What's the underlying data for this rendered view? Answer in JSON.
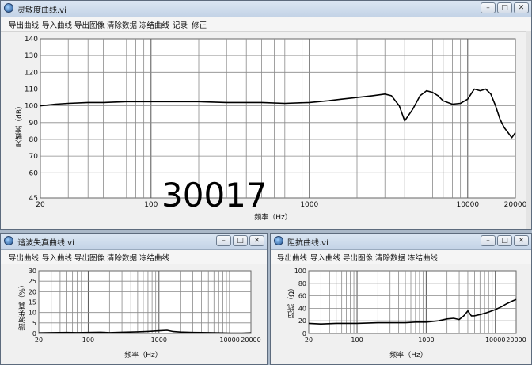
{
  "windows": [
    {
      "id": "sensitivity",
      "title": "灵敏度曲线.vi",
      "menu": [
        "导出曲线",
        "导入曲线",
        "导出图像",
        "清除数据",
        "冻结曲线",
        "记录",
        "修正"
      ],
      "ylabel": "灵敏度（dB）",
      "xlabel": "频率（Hz）"
    },
    {
      "id": "distortion",
      "title": "谐波失真曲线.vi",
      "menu": [
        "导出曲线",
        "导入曲线",
        "导出图像",
        "清除数据",
        "冻结曲线"
      ],
      "ylabel": "谐波失真（%）",
      "xlabel": "频率（Hz）"
    },
    {
      "id": "impedance",
      "title": "阻抗曲线.vi",
      "menu": [
        "导出曲线",
        "导入曲线",
        "导出图像",
        "清除数据",
        "冻结曲线"
      ],
      "ylabel": "阻抗（Ω）",
      "xlabel": "频率（Hz）"
    }
  ],
  "overlay_text": "30017",
  "chart_data": [
    {
      "type": "line",
      "xscale": "log",
      "xlim": [
        20,
        20000
      ],
      "ylim": [
        45,
        140
      ],
      "xticks": [
        20,
        100,
        1000,
        10000,
        20000
      ],
      "xtick_labels": [
        "20",
        "100",
        "1000",
        "10000",
        "20000"
      ],
      "yticks": [
        45,
        60,
        70,
        80,
        90,
        100,
        110,
        120,
        130,
        140
      ],
      "grid": true,
      "series": [
        {
          "x": [
            20,
            25,
            30,
            40,
            50,
            70,
            100,
            150,
            200,
            300,
            500,
            700,
            1000,
            1300,
            1600,
            2000,
            2500,
            3000,
            3300,
            3700,
            4000,
            4500,
            5000,
            5500,
            6000,
            6500,
            7000,
            8000,
            9000,
            10000,
            11000,
            12000,
            13000,
            14000,
            15000,
            16000,
            17000,
            18000,
            19000,
            20000
          ],
          "y": [
            100,
            101,
            101.5,
            102,
            102,
            102.5,
            102.5,
            102.5,
            102.5,
            102,
            102,
            101.5,
            102,
            103,
            104,
            105,
            106,
            107,
            106,
            100,
            91,
            98,
            106,
            109,
            108,
            106,
            103,
            101,
            101.5,
            104,
            110,
            109,
            110,
            107,
            100,
            92,
            87,
            84,
            81,
            84
          ]
        }
      ]
    },
    {
      "type": "line",
      "xscale": "log",
      "xlim": [
        20,
        20000
      ],
      "ylim": [
        0,
        30
      ],
      "xticks": [
        20,
        100,
        1000,
        10000,
        20000
      ],
      "xtick_labels": [
        "20",
        "100",
        "1000",
        "10000",
        "20000"
      ],
      "yticks": [
        0,
        5,
        10,
        15,
        20,
        25,
        30
      ],
      "grid": true,
      "series": [
        {
          "x": [
            20,
            30,
            50,
            70,
            100,
            150,
            200,
            300,
            500,
            700,
            1000,
            1300,
            1600,
            2000,
            3000,
            5000,
            7000,
            10000,
            15000,
            20000
          ],
          "y": [
            0.3,
            0.4,
            0.5,
            0.4,
            0.5,
            0.6,
            0.4,
            0.6,
            0.8,
            1.0,
            1.3,
            1.5,
            0.9,
            0.7,
            0.5,
            0.4,
            0.3,
            0.2,
            0.2,
            0.3
          ]
        }
      ]
    },
    {
      "type": "line",
      "xscale": "log",
      "xlim": [
        20,
        20000
      ],
      "ylim": [
        0,
        100
      ],
      "xticks": [
        20,
        100,
        1000,
        10000,
        20000
      ],
      "xtick_labels": [
        "20",
        "100",
        "1000",
        "10000",
        "20000"
      ],
      "yticks": [
        0,
        20,
        40,
        60,
        80,
        100
      ],
      "grid": true,
      "series": [
        {
          "x": [
            20,
            30,
            50,
            100,
            200,
            300,
            500,
            700,
            1000,
            1500,
            2000,
            2500,
            3000,
            3500,
            4000,
            4500,
            5000,
            6000,
            7000,
            8000,
            10000,
            12000,
            15000,
            18000,
            20000
          ],
          "y": [
            16,
            15,
            16,
            16,
            17,
            17,
            17,
            18,
            18,
            20,
            23,
            24,
            22,
            28,
            36,
            28,
            28,
            30,
            32,
            34,
            38,
            42,
            48,
            52,
            54
          ]
        }
      ]
    }
  ]
}
